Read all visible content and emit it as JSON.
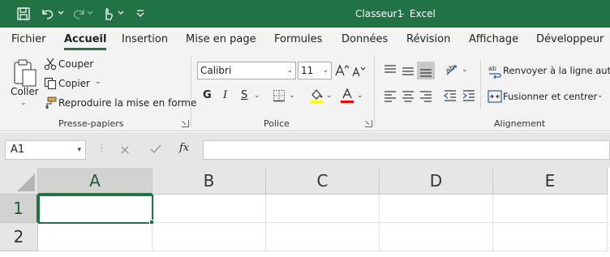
{
  "title": {
    "doc": "Classeur1",
    "sep": "-",
    "app": "Excel"
  },
  "tabs": [
    "Fichier",
    "Accueil",
    "Insertion",
    "Mise en page",
    "Formules",
    "Données",
    "Révision",
    "Affichage",
    "Développeur"
  ],
  "active_tab": "Accueil",
  "clipboard": {
    "paste": "Coller",
    "cut": "Couper",
    "copy": "Copier",
    "format_painter": "Reproduire la mise en forme",
    "group_label": "Presse-papiers"
  },
  "font": {
    "name": "Calibri",
    "size": "11",
    "bold": "G",
    "italic": "I",
    "underline": "S",
    "group_label": "Police",
    "fill_color": "#ffff00",
    "font_color": "#ff0000"
  },
  "alignment": {
    "wrap": "Renvoyer à la ligne autom",
    "merge": "Fusionner et centrer",
    "group_label": "Alignement"
  },
  "formula_bar": {
    "name_box": "A1",
    "fx": "fx",
    "value": ""
  },
  "grid": {
    "columns": [
      "A",
      "B",
      "C",
      "D",
      "E"
    ],
    "rows": [
      "1",
      "2"
    ],
    "active_cell": "A1"
  },
  "colors": {
    "accent": "#217346",
    "ribbon_bg": "#f3f3f3",
    "header_bg": "#e6e6e6"
  }
}
